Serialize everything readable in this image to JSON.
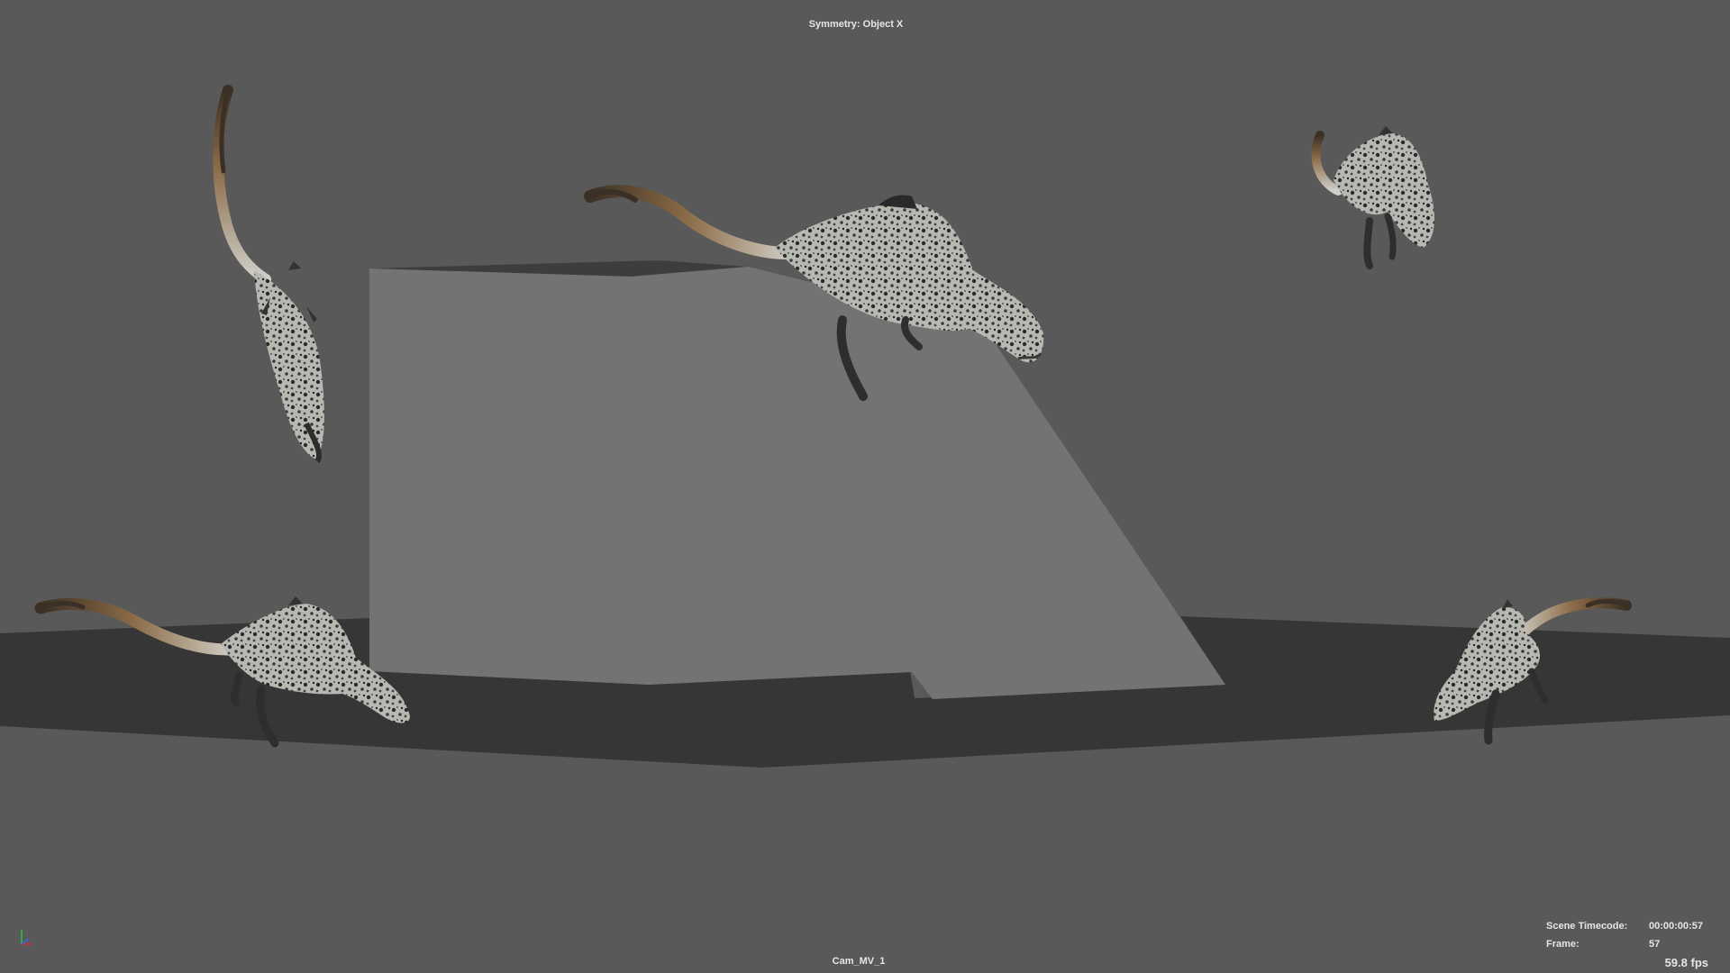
{
  "viewport": {
    "symmetry_label": "Symmetry: Object X",
    "camera_name": "Cam_MV_1",
    "fps": "59.8 fps"
  },
  "hud": {
    "timecode_label": "Scene Timecode:",
    "timecode_value": "00:00:00:57",
    "frame_label": "Frame:",
    "frame_value": "57"
  },
  "colors": {
    "background": "#595959",
    "ground_plane": "#363636",
    "ramp_face": "#737373",
    "ramp_top": "#3d3d3d",
    "hud_text": "#e6e6e6",
    "axis_x": "#d03030",
    "axis_y": "#30c040",
    "axis_z": "#4060e0"
  },
  "scene": {
    "objects": [
      {
        "name": "dinosaur-model-falling-left"
      },
      {
        "name": "dinosaur-model-leaping-center"
      },
      {
        "name": "dinosaur-model-top-right"
      },
      {
        "name": "dinosaur-model-bottom-left"
      },
      {
        "name": "dinosaur-model-bottom-right"
      }
    ]
  }
}
